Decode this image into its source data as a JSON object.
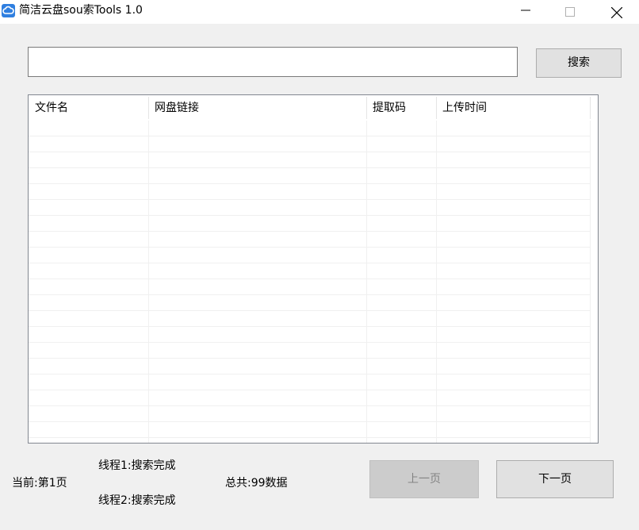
{
  "window": {
    "title": "简洁云盘sou索Tools 1.0"
  },
  "search": {
    "value": "",
    "placeholder": "",
    "button_label": "搜索"
  },
  "table": {
    "columns": [
      "文件名",
      "网盘链接",
      "提取码",
      "上传时间"
    ],
    "rows": []
  },
  "status": {
    "current_page": "当前:第1页",
    "thread1": "线程1:搜索完成",
    "thread2": "线程2:搜索完成",
    "total": "总共:99数据"
  },
  "pagination": {
    "prev_label": "上一页",
    "next_label": "下一页",
    "prev_enabled": false
  },
  "icons": {
    "app": "cloud-icon",
    "minimize": "minimize-icon",
    "maximize": "maximize-icon",
    "close": "close-icon"
  },
  "colors": {
    "app_icon": "#2f7fe0",
    "window_bg": "#f0f0f0",
    "button_bg": "#e1e1e1",
    "disabled_button_bg": "#cccccc"
  }
}
